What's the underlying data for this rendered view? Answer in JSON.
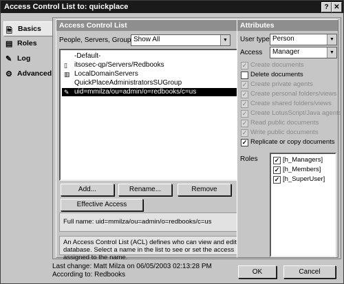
{
  "window": {
    "title": "Access Control List to: quickplace",
    "help_label": "?",
    "close_label": "✕"
  },
  "sidebar": {
    "items": [
      {
        "label": "Basics",
        "icon": "🗎"
      },
      {
        "label": "Roles",
        "icon": "▤"
      },
      {
        "label": "Log",
        "icon": "✎"
      },
      {
        "label": "Advanced",
        "icon": "⚙"
      }
    ]
  },
  "acl": {
    "header": "Access Control List",
    "filter_label": "People, Servers, Groups",
    "filter_value": "Show All",
    "entries": [
      {
        "name": "-Default-",
        "icon": ""
      },
      {
        "name": "itsosec-qp/Servers/Redbooks",
        "icon": "▯"
      },
      {
        "name": "LocalDomainServers",
        "icon": "▥"
      },
      {
        "name": "QuickPlaceAdministratorsSUGroup",
        "icon": ""
      },
      {
        "name": "uid=mmilza/ou=admin/o=redbooks/c=us",
        "icon": "✎"
      }
    ],
    "buttons": {
      "add": "Add...",
      "rename": "Rename...",
      "remove": "Remove",
      "effective": "Effective Access"
    },
    "full_name": "Full name: uid=mmilza/ou=admin/o=redbooks/c=us",
    "help_text": "An Access Control List (ACL) defines who can view and edit your database. Select a name in the list to see or set the access assigned to the name."
  },
  "attributes": {
    "header": "Attributes",
    "user_type_label": "User type",
    "user_type_value": "Person",
    "access_label": "Access",
    "access_value": "Manager",
    "options": [
      {
        "label": "Create documents",
        "checked": true,
        "enabled": false
      },
      {
        "label": "Delete documents",
        "checked": false,
        "enabled": true
      },
      {
        "label": "Create private agents",
        "checked": true,
        "enabled": false
      },
      {
        "label": "Create personal folders/views",
        "checked": true,
        "enabled": false
      },
      {
        "label": "Create shared folders/views",
        "checked": true,
        "enabled": false
      },
      {
        "label": "Create LotusScript/Java agents",
        "checked": true,
        "enabled": false
      },
      {
        "label": "Read public documents",
        "checked": true,
        "enabled": false
      },
      {
        "label": "Write public documents",
        "checked": true,
        "enabled": false
      },
      {
        "label": "Replicate or copy documents",
        "checked": true,
        "enabled": true
      }
    ],
    "roles_label": "Roles",
    "roles": [
      {
        "label": "[h_Managers]",
        "checked": true
      },
      {
        "label": "[h_Members]",
        "checked": true
      },
      {
        "label": "[h_SuperUser]",
        "checked": true
      }
    ]
  },
  "footer": {
    "last_change": "Last change: Matt Milza on 06/05/2003 02:13:28 PM",
    "according_to": "According to: Redbooks",
    "ok": "OK",
    "cancel": "Cancel"
  }
}
